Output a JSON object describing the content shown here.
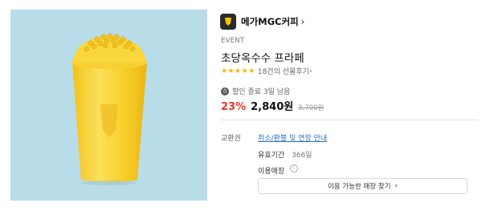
{
  "brand": {
    "name": "메가MGC커피",
    "chevron": "›"
  },
  "product": {
    "event": "EVENT",
    "title": "초당옥수수 프라페",
    "stars": "★★★★★",
    "review_text": "18건의 선물후기",
    "review_chevron": "›",
    "sale_notice": "할인 종료 3일 남음",
    "discount": "23%",
    "price": "2,840원",
    "original_price": "3,700원"
  },
  "details": {
    "exchange_label": "교환권",
    "exchange_link": "취소/환불 및 연장 안내",
    "validity_label": "유효기간",
    "validity_value": "366일",
    "store_label": "이용매장",
    "find_button_label": "이용 가능한 매장 찾기",
    "find_button_chevron": "›"
  },
  "colors": {
    "photo_background": "#b9dce9",
    "discount": "#e8382f",
    "link": "#2f6ecb",
    "stars": "#f2b600"
  },
  "icons": [
    "brand-logo-icon",
    "clock-icon",
    "info-icon",
    "chevron-right-icon"
  ]
}
